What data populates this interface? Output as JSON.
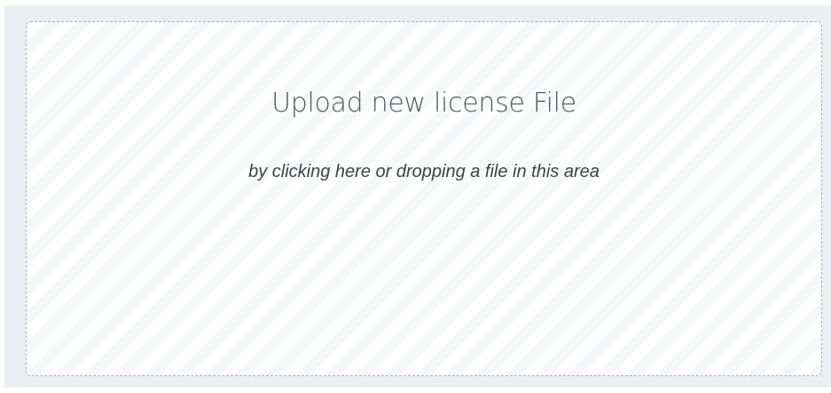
{
  "upload": {
    "title": "Upload new license File",
    "hint": "by clicking here or dropping a file in this area"
  }
}
